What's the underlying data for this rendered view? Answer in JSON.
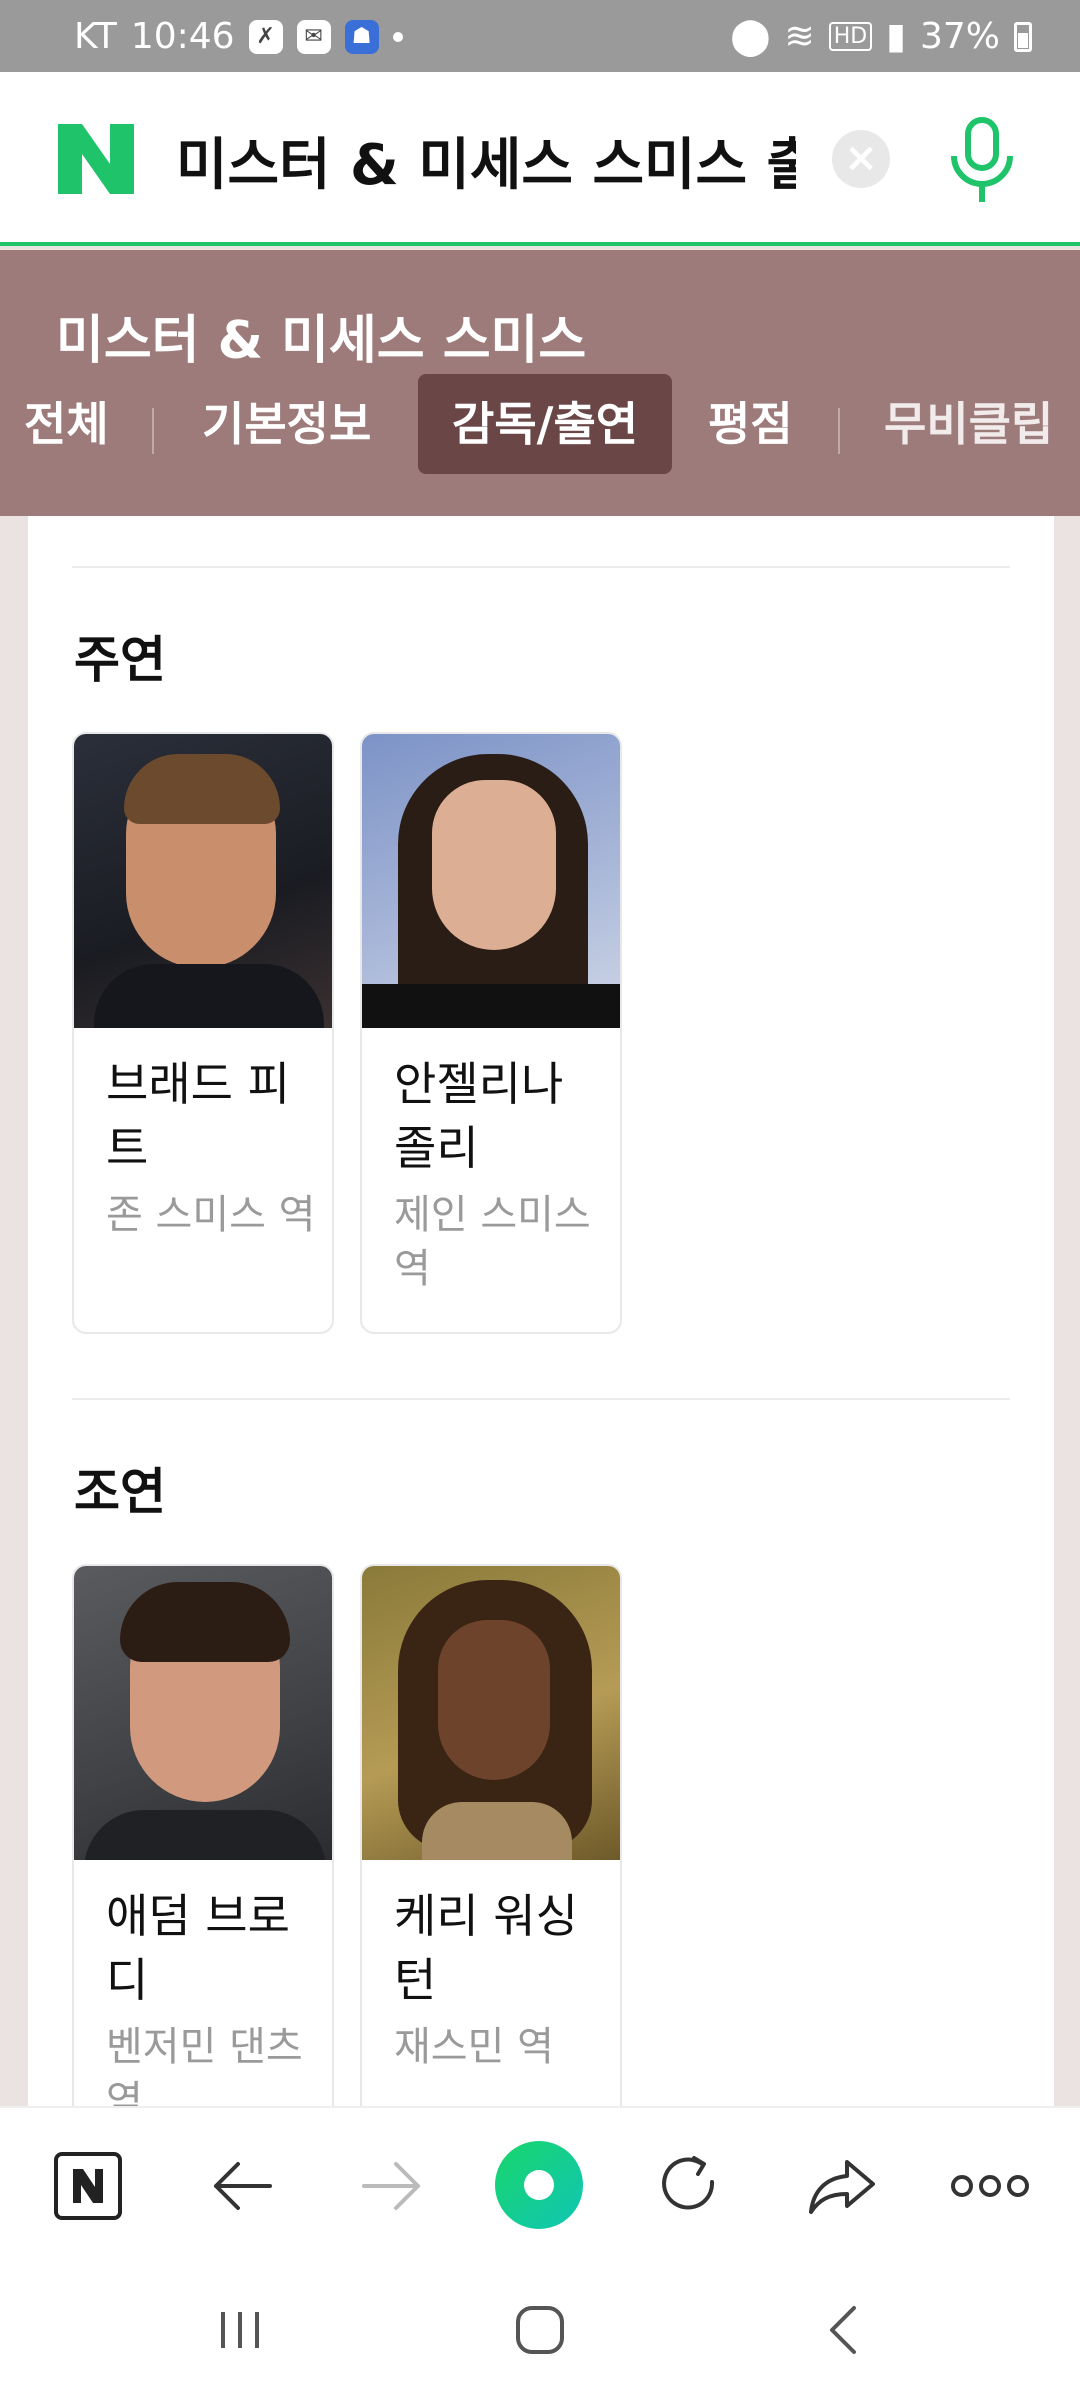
{
  "status_bar": {
    "carrier": "KT",
    "time": "10:46",
    "hd_label": "HD",
    "battery_percent": "37%"
  },
  "search": {
    "query": "미스터 & 미세스 스미스 출"
  },
  "movie": {
    "title": "미스터 & 미세스 스미스"
  },
  "tabs": [
    {
      "label": "전체",
      "active": false
    },
    {
      "label": "기본정보",
      "active": false
    },
    {
      "label": "감독/출연",
      "active": true
    },
    {
      "label": "평점",
      "active": false
    },
    {
      "label": "무비클립",
      "active": false
    }
  ],
  "sections": [
    {
      "title": "주연",
      "people": [
        {
          "name": "브래드 피트",
          "role": "존 스미스 역"
        },
        {
          "name": "안젤리나 졸리",
          "role": "제인 스미스 역"
        }
      ]
    },
    {
      "title": "조연",
      "people": [
        {
          "name": "애덤 브로디",
          "role": "벤저민 댄츠 역"
        },
        {
          "name": "케리 워싱턴",
          "role": "재스민 역"
        }
      ]
    }
  ],
  "colors": {
    "brand_green": "#1fc46a",
    "band": "#9e7b7b",
    "active_tab": "#6a4646"
  },
  "toolbar_icons": [
    "naver-home-icon",
    "back-arrow-icon",
    "forward-arrow-icon",
    "green-dot-icon",
    "refresh-icon",
    "share-icon",
    "more-icon"
  ]
}
